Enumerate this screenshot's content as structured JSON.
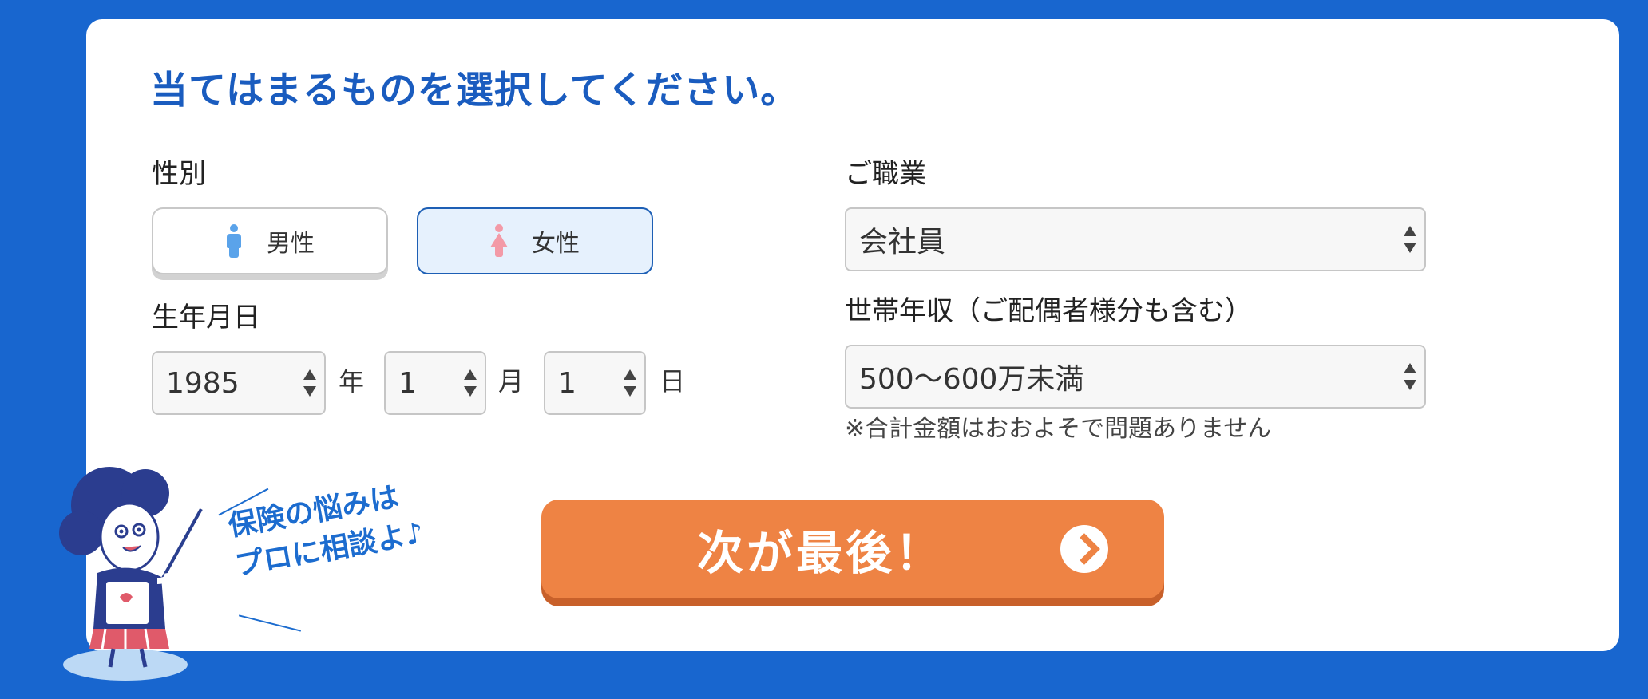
{
  "heading": "当てはまるものを選択してください。",
  "gender": {
    "label": "性別",
    "options": [
      "男性",
      "女性"
    ],
    "selected": "女性"
  },
  "birthdate": {
    "label": "生年月日",
    "year": "1985",
    "year_unit": "年",
    "month": "1",
    "month_unit": "月",
    "day": "1",
    "day_unit": "日"
  },
  "occupation": {
    "label": "ご職業",
    "value": "会社員"
  },
  "income": {
    "label": "世帯年収（ご配偶者様分も含む）",
    "value": "500〜600万未満",
    "note": "※合計金額はおおよそで問題ありません"
  },
  "next_button": {
    "label": "次が最後！",
    "icon": "chevron-right-circle-icon"
  },
  "mascot": {
    "speech_line1": "保険の悩みは",
    "speech_line2": "プロに相談よ♪"
  },
  "colors": {
    "background": "#1866cf",
    "accent": "#1a5cbf",
    "button": "#ee8344"
  }
}
